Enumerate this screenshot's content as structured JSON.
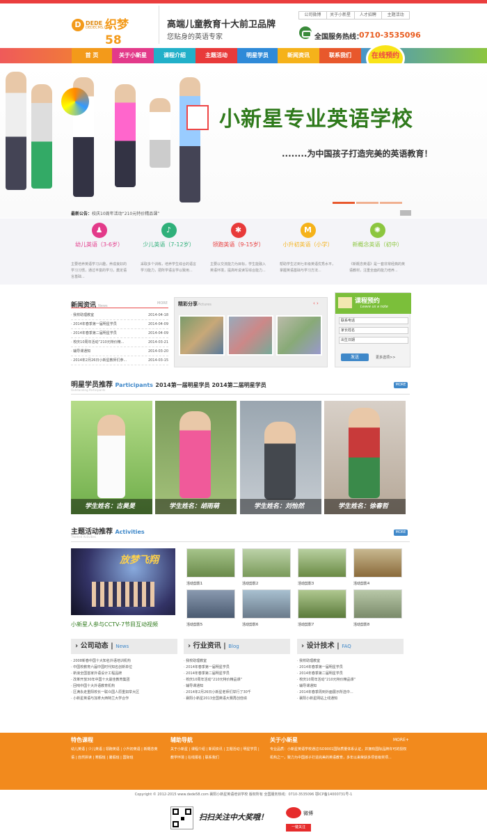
{
  "header": {
    "logo_letter": "D",
    "logo_small": "DEDE",
    "logo_small2": "DEDECMS.COM",
    "logo_big": "织梦58",
    "slogan_main": "高端儿童教育十大前卫品牌",
    "slogan_sub": "您贴身的英语专家",
    "top_links": [
      "公司微博",
      "关于小新星",
      "人才招聘",
      "主题活动"
    ],
    "phone_label": "全国服务热线：",
    "phone_number": "0710-3535096"
  },
  "nav": {
    "items": [
      "首 页",
      "关于小新星",
      "课程介绍",
      "主题活动",
      "明星学员",
      "新闻资讯",
      "联系我们"
    ],
    "colors": [
      "#f39a1a",
      "#e33a8a",
      "#22b0c9",
      "#e83a3a",
      "#2f8ad8",
      "#f5b21a",
      "#e8582c"
    ],
    "online_booking": "在线预约"
  },
  "banner": {
    "title": "小新星专业英语学校",
    "subtitle": "........为中国孩子打造完美的英语教育！",
    "notice_label": "最新公告：",
    "notice_text": "校庆10周年活动“210元特价精品课”"
  },
  "courses": [
    {
      "icon": "♟",
      "color": "#e33a8a",
      "title": "幼儿英语（3-6岁）",
      "desc": "主要培养英语学习兴趣，养成良好的学习习惯，通过丰富的学习，奠定语言基础..."
    },
    {
      "icon": "♪",
      "color": "#2fb07a",
      "title": "少儿英语（7-12岁）",
      "desc": "采取多个训练，培养学生综合的语言学习能力，把所学语言学以致用..."
    },
    {
      "icon": "✱",
      "color": "#e83a3a",
      "title": "领跑英语（9-15岁）",
      "desc": "主要以交流能力为目标，学生能融入英语环境，提高听说读写综合能力..."
    },
    {
      "icon": "M",
      "color": "#f5b21a",
      "title": "小升初英语（小学）",
      "desc": "帮助学生达到七年级英语优秀水平，掌握英语基础与学习方法..."
    },
    {
      "icon": "✺",
      "color": "#8cc63f",
      "title": "新概念英语（初中）",
      "desc": "《新概念英语》是一套非常经典的英语教材，注重全面的能力培养..."
    }
  ],
  "news": {
    "title": "新闻资讯",
    "title_en": "News",
    "more": "MORE",
    "items": [
      {
        "title": "· 我校助理教室",
        "date": "2014-04-18"
      },
      {
        "title": "· 2014年春季第一届明星学员",
        "date": "2014-04-09"
      },
      {
        "title": "· 2014年春季第二届明星学员",
        "date": "2014-04-09"
      },
      {
        "title": "· 校庆10周年活动“210元特价精...",
        "date": "2014-03-21"
      },
      {
        "title": "· 辅导课通知",
        "date": "2014-03-20"
      },
      {
        "title": "· 2014年2月26日小新星教师们参...",
        "date": "2014-03-15"
      }
    ]
  },
  "photos": {
    "title": "精彩分享",
    "title_en": "Pictures"
  },
  "booking": {
    "title": "课程预约",
    "title_en": "Leave us a note",
    "fields": [
      "联系电话",
      "家长姓名",
      "出生日期"
    ],
    "send": "发送",
    "more_options": "更多选项>>"
  },
  "stars": {
    "title": "明星学员推荐",
    "title_en": "Participants",
    "subtitle": "2014第一届明星学员 2014第二届明星学员",
    "sub_en": "Outstanding Participants",
    "more": "MORE",
    "students": [
      {
        "caption": "学生姓名：古昊旻",
        "color": "#8fbf6a"
      },
      {
        "caption": "学生姓名：胡雨萌",
        "color": "#c94a7a"
      },
      {
        "caption": "学生姓名：刘怡然",
        "color": "#7a8a9a"
      },
      {
        "caption": "学生姓名：徐春哲",
        "color": "#a63a3a"
      }
    ]
  },
  "activities": {
    "title": "主题活动推荐",
    "title_en": "Activities",
    "sub_en": "Themed Activities",
    "more": "MORE",
    "feature_caption": "小新星人参与CCTV-7节目互动视频",
    "stage_text": "放梦飞翔",
    "items": [
      "活动剪影1",
      "活动剪影2",
      "活动剪影3",
      "活动剪影4",
      "活动剪影5",
      "活动剪影6",
      "活动剪影7",
      "活动剪影8"
    ]
  },
  "columns": [
    {
      "title": "公司动态",
      "title_en": "News",
      "items": [
        "· 2008新春中国十大知名外语培训机构",
        "· 中国校教育六届中国时代知名创新单位",
        "· 新浪全国首家外语设计工程品牌",
        "· 改革开放30年中国十大最佳教育集团",
        "· 回响中国十大外语教育机构",
        "· 区满永走重阳校长一联众国人原重如举大区",
        "· 小新星英语与加拿大西特兰大学合作"
      ]
    },
    {
      "title": "行业资讯",
      "title_en": "Blog",
      "items": [
        "· 我校助理教室",
        "· 2014年春季第一届明星学员",
        "· 2014年春季第二届明星学员",
        "· 校庆10周年活动“210元特价精品课”",
        "· 辅导课通知",
        "· 2014年2月26日小新星老师们举行了30千",
        "· 襄阳小新星2013全国英语大赛再创佳绩"
      ]
    },
    {
      "title": "设计技术",
      "title_en": "FAQ",
      "items": [
        "· 我校助理教室",
        "· 2014年春季第一届明星学员",
        "· 2014年春季第二届明星学员",
        "· 校庆10周年活动“210元特价精品课”",
        "· 辅导课通知",
        "· 2014年春季周到外面展示所选中...",
        "· 襄阳小新星网站上线通知"
      ]
    }
  ],
  "footer": {
    "col1_title": "特色课程",
    "col1_links": "幼儿英语 | 少儿英语 | 领跑英语 | 小升初英语 | 新概念英语 | 自然拼读 | 寒假班 | 暑假班 | 国际班",
    "col2_title": "辅助导航",
    "col2_links": "关于小新星 | 课程介绍 | 新闻资讯 | 主题活动 | 明星学员 | 教学环境 | 在线报名 | 联系我们",
    "col3_title": "关于小新星",
    "col3_more": "MORE+",
    "col3_text": "专业品质：小新星英语学校通过ISO9001国际质量体系认证，并拥有国际品牌许可的授权机构之一，致力为中国孩子打造完美的英语教育，多年以来荣获多项省级奖项...",
    "copyright": "Copyright © 2012-2015 www.dede58.com 襄阳小新星英语培训学校 版权所有 全国服务热线：0710-3535096 鄂ICP备14000731号-1",
    "qr_text": "扫扫关注中大奖哦！",
    "weibo_label": "微博",
    "follow_btn": "一键关注"
  }
}
